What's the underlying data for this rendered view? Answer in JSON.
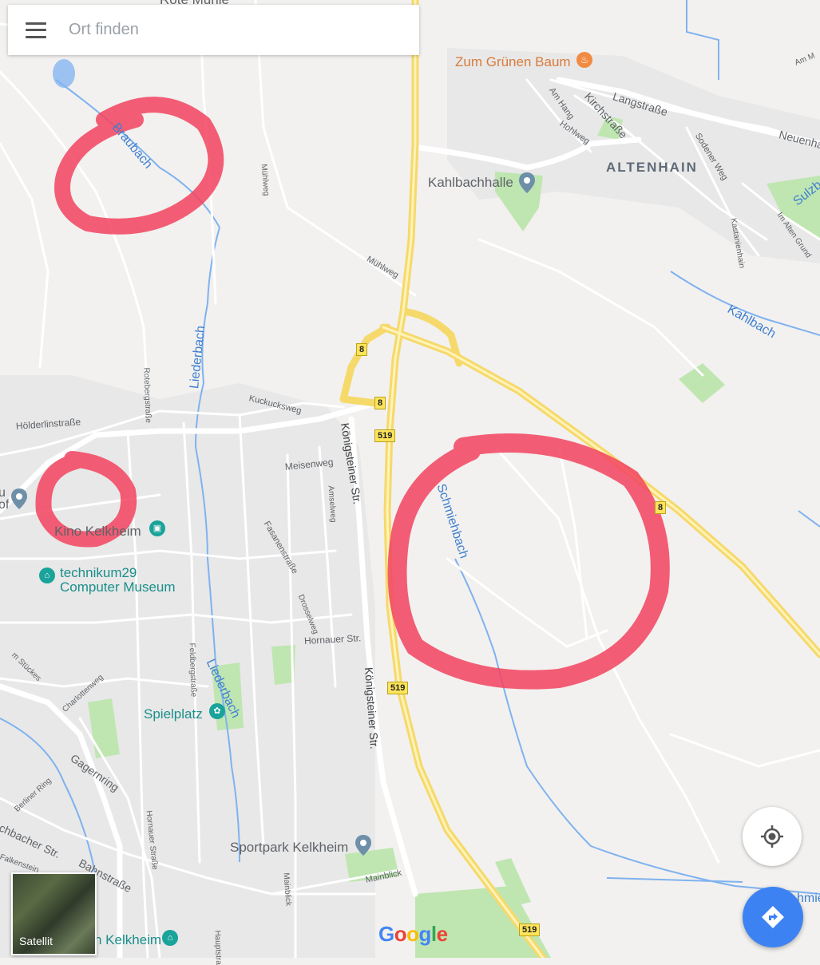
{
  "search": {
    "placeholder": "Ort finden"
  },
  "town": {
    "name": "ALTENHAIN"
  },
  "pois": {
    "rote_muehle": "Rote Mühle",
    "zum_gruenen_baum": "Zum Grünen Baum",
    "kahlbachhalle": "Kahlbachhalle",
    "kino": "Kino Kelkheim",
    "museum_line1": "technikum29",
    "museum_line2": "Computer Museum",
    "spielplatz": "Spielplatz",
    "sportpark": "Sportpark Kelkheim",
    "kelkheim_bottom": "n Kelkheim",
    "cut_left": "u\nof"
  },
  "streets": {
    "langstrasse": "Langstraße",
    "kirchstrasse": "Kirchstraße",
    "am_hang": "Am Hang",
    "hohlweg": "Hohlweg",
    "sodener_weg": "Sodener Weg",
    "kastanienhain": "Kastanienhain",
    "im_alten_grund": "Im Alten Grund",
    "neuenhain": "Neuenha",
    "am_m": "Am M",
    "muehlweg1": "Mühlweg",
    "muehlweg2": "Mühlweg",
    "rotebergstrasse": "Rotebergstraße",
    "kuckucksweg": "Kuckucksweg",
    "hoelderlinstrasse": "Hölderlinstraße",
    "meisenweg": "Meisenweg",
    "amselweg": "Amselweg",
    "fasanenstrasse": "Fasanenstraße",
    "drosselweg": "Drosselweg",
    "hornauer_str": "Hornauer Str.",
    "koenigsteiner_str1": "Königsteiner Str.",
    "koenigsteiner_str2": "Königsteiner Str.",
    "feldbergstrasse": "Feldbergstraße",
    "charlottenweg": "Charlottenweg",
    "stuecks": "m Stückes",
    "gagernring": "Gagernring",
    "berliner_ring": "Berliner Ring",
    "schbacher_str": "chbacher Str.",
    "falkenstein": "Falkenstein",
    "bahnstrasse": "Bahnstraße",
    "hornauer_strasse": "Hornauer Straße",
    "mainblick1": "Mainblick",
    "mainblick2": "Mainblick",
    "hauptstrasse": "Hauptstra"
  },
  "waters": {
    "braubach": "Braubach",
    "liederbach1": "Liederbach",
    "liederbach2": "Liederbach",
    "schmiehbach": "Schmiehbach",
    "kahlbach": "Kahlbach",
    "sulzbach": "Sulzb",
    "schmie_right": "hmie"
  },
  "shields": {
    "b8": "8",
    "b519": "519"
  },
  "map_controls": {
    "satellite_label": "Satellit",
    "google_logo": [
      "G",
      "o",
      "o",
      "g",
      "l",
      "e"
    ],
    "google_colors": [
      "#4285f4",
      "#ea4335",
      "#fbbc05",
      "#4285f4",
      "#34a853",
      "#ea4335"
    ]
  },
  "colors": {
    "map_bg": "#f2f1ef",
    "road": "#ffffff",
    "highway": "#fbe38a",
    "water": "#4a8de0",
    "park": "#bfe6b1",
    "annotation": "#f2435f",
    "accent_blue": "#3c82f2"
  },
  "icons": {
    "menu": "hamburger-menu-icon",
    "pin": "map-pin-icon",
    "locate": "my-location-icon",
    "directions": "directions-icon",
    "restaurant": "fork-knife-icon",
    "theater": "theater-icon",
    "museum": "museum-icon",
    "playground": "playground-icon"
  }
}
